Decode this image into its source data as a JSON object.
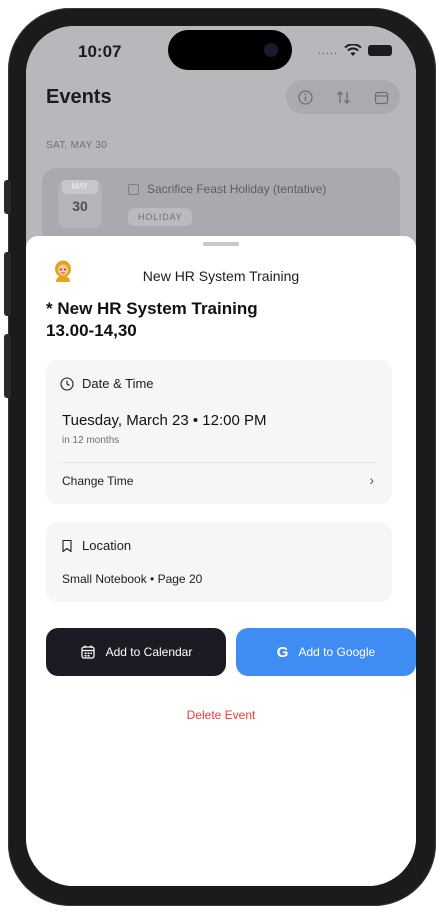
{
  "status_bar": {
    "time": "10:07",
    "signal_dots": "....."
  },
  "background": {
    "title": "Events",
    "date_header": "SAT, MAY 30",
    "event_card": {
      "badge_month": "MAY",
      "badge_day": "30",
      "title": "Sacrifice Feast Holiday (tentative)",
      "tag": "HOLIDAY"
    },
    "icons": [
      "info-icon",
      "sort-icon",
      "calendar-icon"
    ]
  },
  "sheet": {
    "header_title": "New HR System Training",
    "header_emoji": "person-emoji",
    "event_title_line1": "* New HR System Training",
    "event_title_line2": "13.00-14,30",
    "datetime": {
      "section_label": "Date & Time",
      "value": "Tuesday, March 23 • 12:00 PM",
      "relative": "in 12 months",
      "action_label": "Change Time"
    },
    "location": {
      "section_label": "Location",
      "value": "Small Notebook • Page 20"
    },
    "actions": {
      "add_calendar": "Add to Calendar",
      "add_google": "Add to Google",
      "delete": "Delete Event"
    }
  },
  "colors": {
    "primary_dark": "#1b1b24",
    "google_blue": "#3f8cf2",
    "danger": "#ee3b3b",
    "card_bg": "#f4f6f8"
  }
}
